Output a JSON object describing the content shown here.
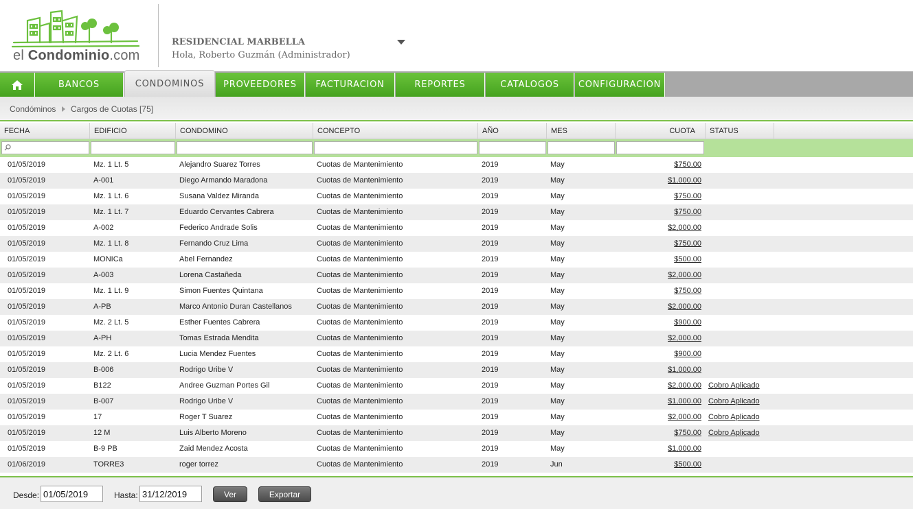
{
  "brand": {
    "logo_text_light": "el ",
    "logo_text_bold": "Condominio",
    "logo_text_suffix": ".com"
  },
  "header": {
    "condo_name": "RESIDENCIAL MARBELLA",
    "greeting": "Hola, Roberto Guzmán (Administrador)"
  },
  "nav": {
    "home_icon": "home-icon",
    "items": [
      "BANCOS",
      "CONDOMINOS",
      "PROVEEDORES",
      "FACTURACION",
      "REPORTES",
      "CATALOGOS",
      "CONFIGURACION"
    ],
    "active": "CONDOMINOS"
  },
  "breadcrumb": {
    "root": "Condóminos",
    "current": "Cargos de Cuotas [75]"
  },
  "table": {
    "columns": [
      "FECHA",
      "EDIFICIO",
      "CONDOMINO",
      "CONCEPTO",
      "AÑO",
      "MES",
      "CUOTA",
      "STATUS"
    ],
    "rows": [
      [
        "01/05/2019",
        "Mz. 1 Lt. 5",
        "Alejandro Suarez Torres",
        "Cuotas de Mantenimiento",
        "2019",
        "May",
        "$750.00",
        ""
      ],
      [
        "01/05/2019",
        "A-001",
        "Diego Armando Maradona",
        "Cuotas de Mantenimiento",
        "2019",
        "May",
        "$1,000.00",
        ""
      ],
      [
        "01/05/2019",
        "Mz. 1 Lt. 6",
        "Susana Valdez Miranda",
        "Cuotas de Mantenimiento",
        "2019",
        "May",
        "$750.00",
        ""
      ],
      [
        "01/05/2019",
        "Mz. 1 Lt. 7",
        "Eduardo Cervantes Cabrera",
        "Cuotas de Mantenimiento",
        "2019",
        "May",
        "$750.00",
        ""
      ],
      [
        "01/05/2019",
        "A-002",
        "Federico Andrade Solis",
        "Cuotas de Mantenimiento",
        "2019",
        "May",
        "$2,000.00",
        ""
      ],
      [
        "01/05/2019",
        "Mz. 1 Lt. 8",
        "Fernando Cruz Lima",
        "Cuotas de Mantenimiento",
        "2019",
        "May",
        "$750.00",
        ""
      ],
      [
        "01/05/2019",
        "MONICa",
        "Abel Fernandez",
        "Cuotas de Mantenimiento",
        "2019",
        "May",
        "$500.00",
        ""
      ],
      [
        "01/05/2019",
        "A-003",
        "Lorena Castañeda",
        "Cuotas de Mantenimiento",
        "2019",
        "May",
        "$2,000.00",
        ""
      ],
      [
        "01/05/2019",
        "Mz. 1 Lt. 9",
        "Simon Fuentes Quintana",
        "Cuotas de Mantenimiento",
        "2019",
        "May",
        "$750.00",
        ""
      ],
      [
        "01/05/2019",
        "A-PB",
        "Marco Antonio Duran Castellanos",
        "Cuotas de Mantenimiento",
        "2019",
        "May",
        "$2,000.00",
        ""
      ],
      [
        "01/05/2019",
        "Mz. 2 Lt. 5",
        "Esther Fuentes Cabrera",
        "Cuotas de Mantenimiento",
        "2019",
        "May",
        "$900.00",
        ""
      ],
      [
        "01/05/2019",
        "A-PH",
        "Tomas Estrada Mendita",
        "Cuotas de Mantenimiento",
        "2019",
        "May",
        "$2,000.00",
        ""
      ],
      [
        "01/05/2019",
        "Mz. 2 Lt. 6",
        "Lucia Mendez Fuentes",
        "Cuotas de Mantenimiento",
        "2019",
        "May",
        "$900.00",
        ""
      ],
      [
        "01/05/2019",
        "B-006",
        "Rodrigo Uribe V",
        "Cuotas de Mantenimiento",
        "2019",
        "May",
        "$1,000.00",
        ""
      ],
      [
        "01/05/2019",
        "B122",
        "Andree Guzman Portes Gil",
        "Cuotas de Mantenimiento",
        "2019",
        "May",
        "$2,000.00",
        "Cobro Aplicado"
      ],
      [
        "01/05/2019",
        "B-007",
        "Rodrigo Uribe V",
        "Cuotas de Mantenimiento",
        "2019",
        "May",
        "$1,000.00",
        "Cobro Aplicado"
      ],
      [
        "01/05/2019",
        "17",
        "Roger T Suarez",
        "Cuotas de Mantenimiento",
        "2019",
        "May",
        "$2,000.00",
        "Cobro Aplicado"
      ],
      [
        "01/05/2019",
        "12 M",
        "Luis Alberto Moreno",
        "Cuotas de Mantenimiento",
        "2019",
        "May",
        "$750.00",
        "Cobro Aplicado"
      ],
      [
        "01/05/2019",
        "B-9 PB",
        "Zaid Mendez Acosta",
        "Cuotas de Mantenimiento",
        "2019",
        "May",
        "$1,000.00",
        ""
      ],
      [
        "01/06/2019",
        "TORRE3",
        "roger torrez",
        "Cuotas de Mantenimiento",
        "2019",
        "Jun",
        "$500.00",
        ""
      ]
    ]
  },
  "footer": {
    "desde_label": "Desde:",
    "desde_value": "01/05/2019",
    "hasta_label": "Hasta:",
    "hasta_value": "31/12/2019",
    "ver_label": "Ver",
    "exportar_label": "Exportar"
  },
  "colors": {
    "green": "#4fae27",
    "green_light": "#b5e19a",
    "gray_bar": "#a8a8a8"
  }
}
